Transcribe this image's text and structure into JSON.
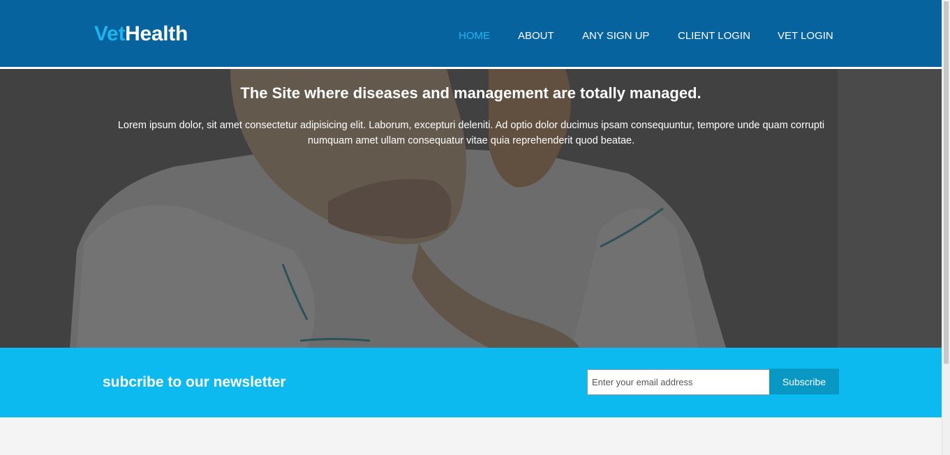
{
  "header": {
    "logo": {
      "part1": "Vet",
      "part2": "Health"
    },
    "nav": [
      {
        "label": "HOME",
        "active": true
      },
      {
        "label": "ABOUT",
        "active": false
      },
      {
        "label": "ANY SIGN UP",
        "active": false
      },
      {
        "label": "CLIENT LOGIN",
        "active": false
      },
      {
        "label": "VET LOGIN",
        "active": false
      }
    ]
  },
  "hero": {
    "title": "The Site where diseases and management are totally managed.",
    "text": "Lorem ipsum dolor, sit amet consectetur adipisicing elit. Laborum, excepturi deleniti. Ad optio dolor ducimus ipsam consequuntur, tempore unde quam corrupti numquam amet ullam consequatur vitae quia reprehenderit quod beatae."
  },
  "newsletter": {
    "title": "subcribe to our newsletter",
    "email_placeholder": "Enter your email address",
    "button_label": "Subscribe"
  },
  "colors": {
    "header_bg": "#06639d",
    "logo_accent": "#1fb3ee",
    "nav_active": "#21b6f2",
    "newsletter_bg": "#0dbaef",
    "button_bg": "#0997c4"
  }
}
